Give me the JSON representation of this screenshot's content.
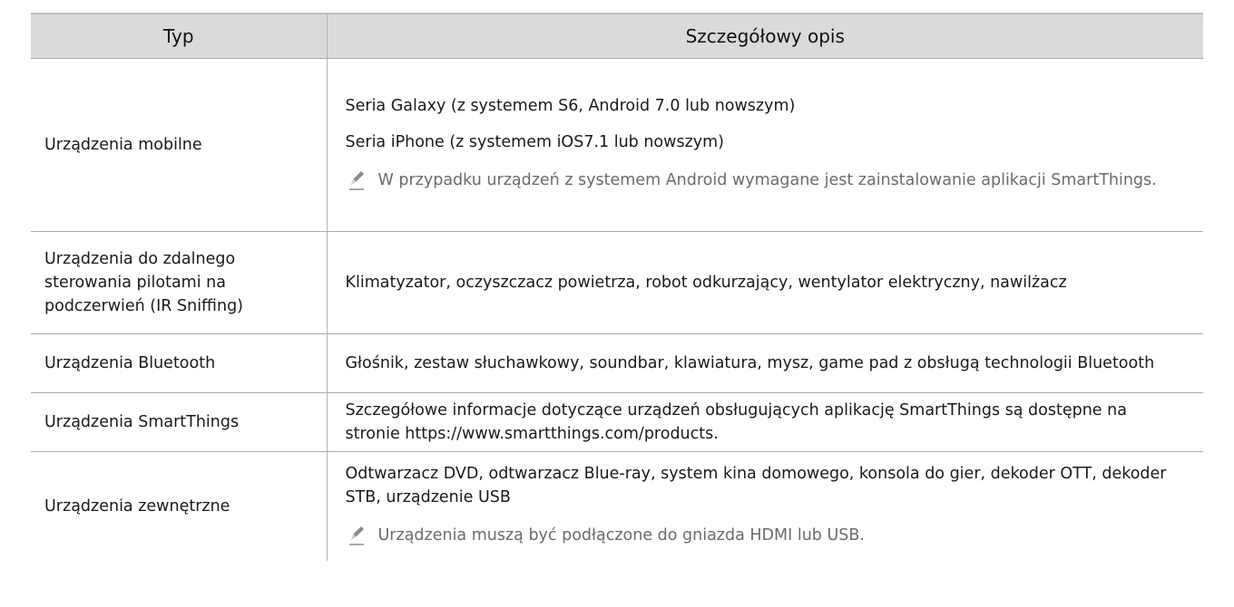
{
  "table": {
    "headers": {
      "type": "Typ",
      "description": "Szczegółowy opis"
    },
    "rows": [
      {
        "type": "Urządzenia mobilne",
        "paragraphs": [
          "Seria Galaxy (z systemem S6, Android 7.0 lub nowszym)",
          "Seria iPhone (z systemem iOS7.1 lub nowszym)"
        ],
        "note": "W przypadku urządzeń z systemem Android wymagane jest zainstalowanie aplikacji SmartThings."
      },
      {
        "type": "Urządzenia do zdalnego sterowania pilotami na podczerwień (IR Sniffing)",
        "paragraphs": [
          "Klimatyzator, oczyszczacz powietrza, robot odkurzający, wentylator elektryczny, nawilżacz"
        ]
      },
      {
        "type": "Urządzenia Bluetooth",
        "paragraphs": [
          "Głośnik, zestaw słuchawkowy, soundbar, klawiatura, mysz, game pad z obsługą technologii Bluetooth"
        ]
      },
      {
        "type": "Urządzenia SmartThings",
        "paragraphs": [
          "Szczegółowe informacje dotyczące urządzeń obsługujących aplikację SmartThings są dostępne na stronie https://www.smartthings.com/products."
        ]
      },
      {
        "type": "Urządzenia zewnętrzne",
        "paragraphs": [
          "Odtwarzacz DVD, odtwarzacz Blue-ray, system kina domowego, konsola do gier, dekoder OTT, dekoder STB, urządzenie USB"
        ],
        "note": "Urządzenia muszą być podłączone do gniazda HDMI lub USB."
      }
    ]
  },
  "icons": {
    "note": "pencil-note-icon"
  },
  "colors": {
    "header_bg": "#dadada",
    "note_text": "#6b6b6b",
    "border": "#a9a9a9"
  }
}
